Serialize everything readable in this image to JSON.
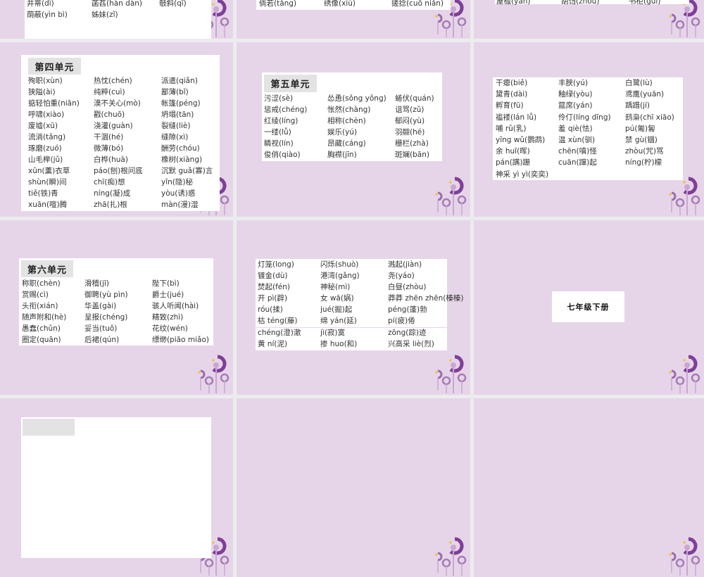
{
  "slides": [
    {
      "rows": [
        [
          "井蒂(dì)",
          "菡萏(hàn dàn)",
          "攲斜(qī)"
        ],
        [
          "荫蔽(yìn bì)",
          "姊妹(zǐ)",
          ""
        ]
      ]
    },
    {
      "rows": [
        [
          "倘若(tǎng)",
          "绣像(xiù)",
          "搓捻(cuō niǎn)"
        ]
      ]
    },
    {
      "rows": [
        [
          "屋檐(yán)",
          "胡诌(zhōu)",
          "书柜(guì)"
        ]
      ]
    },
    {
      "header": "第四单元",
      "rows": [
        [
          "殉职(xùn)",
          "热忱(chén)",
          "派遣(qiǎn)"
        ],
        [
          "狭隘(ài)",
          "纯粹(cuì)",
          "鄙薄(bǐ)"
        ],
        [
          "掂轻怕重(niān)",
          "漠不关心(mò)",
          "帐篷(péng)"
        ],
        [
          "呼啸(xiào)",
          "戳(chuō)",
          "坍塌(tān)"
        ],
        [
          "废墟(xū)",
          "浇灌(guàn)",
          "裂缝(liè)"
        ],
        [
          "流淌(tǎng)",
          "干涸(hé)",
          "缝隙(xì)"
        ],
        [
          "琢磨(zuó)",
          "微薄(bó)",
          "酬劳(chóu)"
        ],
        [
          "山毛榉(jǔ)",
          "白桦(huà)",
          "橡树(xiàng)"
        ],
        [
          "xūn(薰)衣草",
          "páo(刨)根问底",
          "沉默 guǎ(寡)言"
        ],
        [
          "shùn(瞬)间",
          "chī(痴)想",
          "yǐn(隐)秘"
        ],
        [
          "tiě(铁)青",
          "níng(凝)成",
          "yòu(诱)惑"
        ],
        [
          "xuān(喧)腾",
          "zhā(扎)根",
          "màn(漫)湿"
        ]
      ]
    },
    {
      "header": "第五单元",
      "rows": [
        [
          "污涩(sè)",
          "怂恿(sǒng yǒng)",
          "蜷伏(quán)"
        ],
        [
          "惩戒(chéng)",
          "怅然(chàng)",
          "诅骂(zǔ)"
        ],
        [
          "红绫(líng)",
          "相称(chèn)",
          "郁闷(yù)"
        ],
        [
          "一缕(lǚ)",
          "娱乐(yú)",
          "羽翮(hé)"
        ],
        [
          "瞵视(lín)",
          "昂藏(cáng)",
          "栅栏(zhà)"
        ],
        [
          "俊俏(qiào)",
          "胸襟(jīn)",
          "斑斓(bān)"
        ]
      ]
    },
    {
      "rows": [
        [
          "干瘪(biě)",
          "丰腴(yú)",
          "白鹭(lù)"
        ],
        [
          "黛青(dài)",
          "釉绿(yòu)",
          "鸢鹰(yuān)"
        ],
        [
          "孵育(fū)",
          "筵席(yán)",
          "踽踖(jí)"
        ],
        [
          "褴褛(lán lǚ)",
          "伶仃(líng dīng)",
          "鸱枭(chī xiāo)"
        ],
        [
          "哺 rǔ(乳)",
          "羞 qiè(怯)",
          "pú(匍)匐"
        ],
        [
          "yīng wǔ(鹦鹉)",
          "温 xùn(驯)",
          "禁 gù(锢)"
        ],
        [
          "余 huī(晖)",
          "chēn(嗔)怪",
          "zhòu(咒)骂"
        ],
        [
          "pán(蹒)跚",
          "cuān(蹿)起",
          "níng(柠)檬"
        ],
        [
          "神采 yì yì(奕奕)",
          "",
          ""
        ]
      ]
    },
    {
      "header": "第六单元",
      "rows": [
        [
          "称职(chèn)",
          "滑稽(jī)",
          "陛下(bì)"
        ],
        [
          "赏赐(cì)",
          "御聘(yù pìn)",
          "爵士(jué)"
        ],
        [
          "头衔(xián)",
          "华盖(gài)",
          "骇人听闻(hài)"
        ],
        [
          "随声附和(hè)",
          "呈报(chéng)",
          "精致(zhì)"
        ],
        [
          "愚蠢(chǔn)",
          "妥当(tuǒ)",
          "花纹(wén)"
        ],
        [
          "圈定(quān)",
          "后裙(qún)",
          "缥缈(piāo miǎo)"
        ]
      ]
    },
    {
      "rows": [
        [
          "灯笼(long)",
          "闪烁(shuò)",
          "溅起(jiàn)"
        ],
        [
          "镀金(dù)",
          "港湾(gǎng)",
          "尧(yáo)"
        ],
        [
          "焚起(fén)",
          "神秘(mì)",
          "白昼(zhòu)"
        ],
        [
          "开 pì(辟)",
          "女 wā(娲)",
          "莽莽 zhēn zhēn(榛榛)"
        ],
        [
          "róu(揉)",
          "jué(掘)起",
          "péng(蓬)勃"
        ],
        [
          "枯 téng(藤)",
          "绵 yán(延)",
          "pí(疲)倦"
        ]
      ],
      "rows2": [
        [
          "chéng(澄)澈",
          "jì(寂)寞",
          "zōng(踪)迹"
        ],
        [
          "黄 ní(泥)",
          "掺 huo(和)",
          "兴高采 liè(烈)"
        ]
      ]
    },
    {
      "title": "七年级下册"
    }
  ]
}
